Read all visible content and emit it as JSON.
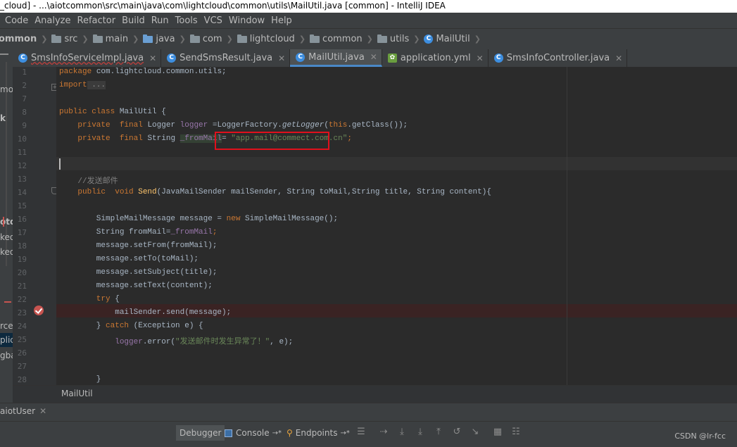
{
  "window": {
    "title": "_cloud] - ...\\aiotcommon\\src\\main\\java\\com\\lightcloud\\common\\utils\\MailUtil.java [common] - IntelliJ IDEA"
  },
  "menu": [
    "Code",
    "Analyze",
    "Refactor",
    "Build",
    "Run",
    "Tools",
    "VCS",
    "Window",
    "Help"
  ],
  "navbar": {
    "crumbs": [
      "ommon",
      "src",
      "main",
      "java",
      "com",
      "lightcloud",
      "common",
      "utils",
      "MailUtil"
    ]
  },
  "left_panel": {
    "fragments": [
      "mo",
      "k",
      "otd",
      "ked",
      "ked",
      "rces",
      "plic",
      "gbac"
    ]
  },
  "tabs": [
    {
      "label": "SmsInfoServiceImpl.java",
      "icon": "C",
      "icon_name": "class-icon",
      "active": false,
      "wavy": true
    },
    {
      "label": "SendSmsResult.java",
      "icon": "C",
      "icon_name": "class-icon",
      "active": false,
      "wavy": false
    },
    {
      "label": "MailUtil.java",
      "icon": "C",
      "icon_name": "class-icon",
      "active": true,
      "wavy": false
    },
    {
      "label": "application.yml",
      "icon": "✿",
      "icon_name": "spring-config-icon",
      "active": false,
      "wavy": false
    },
    {
      "label": "SmsInfoController.java",
      "icon": "C",
      "icon_name": "class-icon",
      "active": false,
      "wavy": false
    }
  ],
  "editor": {
    "line_numbers": [
      "1",
      "2",
      "7",
      "8",
      "9",
      "10",
      "11",
      "12",
      "13",
      "14",
      "15",
      "16",
      "17",
      "18",
      "19",
      "20",
      "21",
      "22",
      "23",
      "24",
      "25",
      "26",
      "27",
      "28"
    ],
    "code": {
      "l1_pkg": "package",
      "l1_rest": " com.lightcloud.common.utils;",
      "l2_kw": "import",
      "l2_fold": " ...",
      "l8_public": "public",
      "l8_class": " class",
      "l8_rest": " MailUtil {",
      "l9_private": "    private",
      "l9_final": "  final",
      "l9_type": " Logger ",
      "l9_field": "logger",
      "l9_eq": " =LoggerFactory.",
      "l9_method": "getLogger",
      "l9_paren": "(",
      "l9_this": "this",
      "l9_end": ".getClass());",
      "l10_private": "    private",
      "l10_final": "  final",
      "l10_type": " String ",
      "l10_field": "_fromMail",
      "l10_eq": "= ",
      "l10_str": "\"app.mail@commect.com.cn\"",
      "l10_end": ";",
      "l13_comment": "    //发送邮件",
      "l14_public": "    public",
      "l14_void": "  void",
      "l14_space": " ",
      "l14_method": "Send",
      "l14_rest": "(JavaMailSender mailSender, String toMail,String title, String content){",
      "l16_a": "        SimpleMailMessage message = ",
      "l16_new": "new",
      "l16_b": " SimpleMailMessage();",
      "l17_a": "        String fromMail=",
      "l17_field": "_fromMail",
      "l17_end": ";",
      "l18": "        message.setFrom(fromMail);",
      "l19": "        message.setTo(toMail);",
      "l20": "        message.setSubject(title);",
      "l21": "        message.setText(content);",
      "l22_try": "        try",
      "l22_end": " {",
      "l23": "            mailSender.send(message);",
      "l24_a": "        } ",
      "l24_catch": "catch",
      "l24_b": " (Exception e) {",
      "l25_pre": "            ",
      "l25_field": "logger",
      "l25_mid": ".error(",
      "l25_str": "\"发送邮件时发生异常了！\"",
      "l25_end": ", e);",
      "l28": "        }"
    }
  },
  "breadcrumb": {
    "label": "MailUtil"
  },
  "debug": {
    "session_tab": "aiotUser"
  },
  "toolbar": {
    "debugger": "Debugger",
    "console": "Console",
    "console_suffix": "→*",
    "endpoints": "Endpoints",
    "endpoints_suffix": "→*"
  },
  "watermark": "CSDN @lr-fcc",
  "colors": {
    "keyword": "#cc7832",
    "field": "#9876aa",
    "string": "#6a8759",
    "annotation_box": "#e0101c"
  }
}
